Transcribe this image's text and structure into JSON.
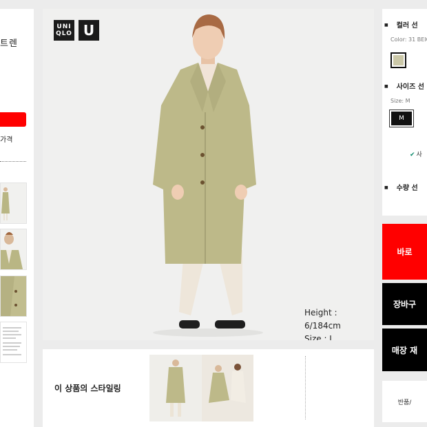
{
  "product": {
    "title_fragment": "트렌",
    "price_fragment": "가격"
  },
  "brand": {
    "logo_top": "UNI",
    "logo_bottom": "QLO",
    "logo_u": "U"
  },
  "hero": {
    "model_height": "Height : 6/184cm",
    "model_size": "Size : L"
  },
  "styling": {
    "title": "이 상품의 스타일링"
  },
  "options": {
    "color_title": "컬러 선",
    "color_label": "Color: 31 BEIG",
    "color_hex": "#cbc8a8",
    "size_title": "사이즈 선",
    "size_label": "Size: M",
    "size_value": "M",
    "size_guide": "사",
    "quantity_title": "수량 선"
  },
  "actions": {
    "buy_now": "바로",
    "cart": "장바구",
    "store": "매장 재",
    "returns": "반품/"
  },
  "colors": {
    "accent_red": "#ff0000",
    "black": "#000000",
    "coat": "#b9b684"
  }
}
